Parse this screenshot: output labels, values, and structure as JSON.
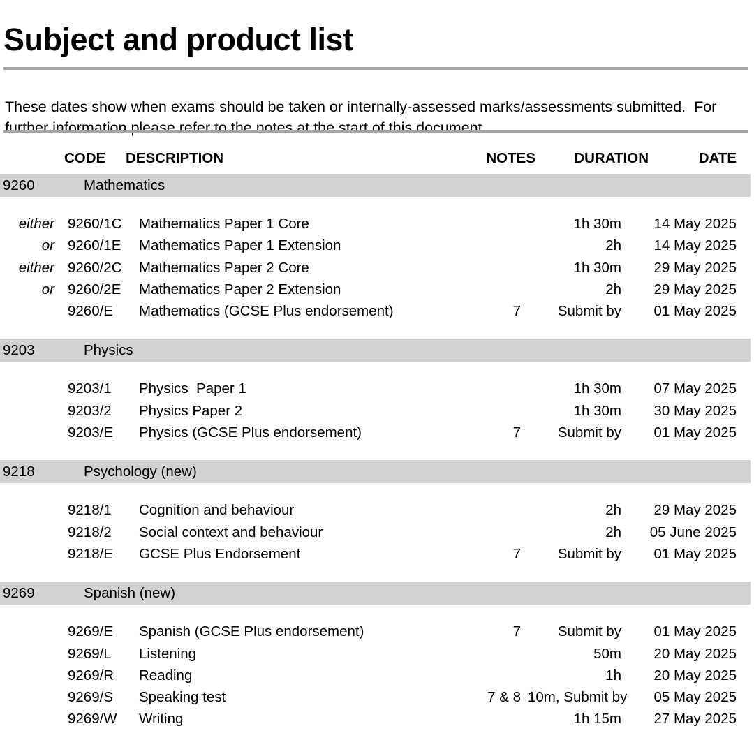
{
  "document": {
    "title": "Subject and product list",
    "intro": "These dates show when exams should be taken or internally-assessed marks/assessments submitted.  For further information please refer to the notes at the start of this document."
  },
  "colors": {
    "rule": "#a6a6a6",
    "subject_band": "#d2d2d2",
    "text": "#000000",
    "page_background": "#ffffff"
  },
  "table": {
    "headers": {
      "code": "CODE",
      "description": "DESCRIPTION",
      "notes": "NOTES",
      "duration": "DURATION",
      "date": "DATE"
    },
    "sections": [
      {
        "subject_code": "9260",
        "subject_name": "Mathematics",
        "rows": [
          {
            "eitheror": "either",
            "code": "9260/1C",
            "description": "Mathematics Paper 1 Core",
            "notes": "",
            "duration": "1h 30m",
            "date": "14 May 2025"
          },
          {
            "eitheror": "or",
            "code": "9260/1E",
            "description": "Mathematics Paper 1 Extension",
            "notes": "",
            "duration": "2h",
            "date": "14 May 2025"
          },
          {
            "eitheror": "either",
            "code": "9260/2C",
            "description": "Mathematics Paper 2 Core",
            "notes": "",
            "duration": "1h 30m",
            "date": "29 May 2025"
          },
          {
            "eitheror": "or",
            "code": "9260/2E",
            "description": "Mathematics Paper 2 Extension",
            "notes": "",
            "duration": "2h",
            "date": "29 May 2025"
          },
          {
            "eitheror": "",
            "code": "9260/E",
            "description": "Mathematics (GCSE Plus endorsement)",
            "notes": "7",
            "duration": "Submit by",
            "date": "01 May 2025"
          }
        ]
      },
      {
        "subject_code": "9203",
        "subject_name": "Physics",
        "rows": [
          {
            "eitheror": "",
            "code": "9203/1",
            "description": "Physics  Paper 1",
            "notes": "",
            "duration": "1h 30m",
            "date": "07 May 2025"
          },
          {
            "eitheror": "",
            "code": "9203/2",
            "description": "Physics Paper 2",
            "notes": "",
            "duration": "1h 30m",
            "date": "30 May 2025"
          },
          {
            "eitheror": "",
            "code": "9203/E",
            "description": "Physics (GCSE Plus endorsement)",
            "notes": "7",
            "duration": "Submit by",
            "date": "01 May 2025"
          }
        ]
      },
      {
        "subject_code": "9218",
        "subject_name": "Psychology (new)",
        "rows": [
          {
            "eitheror": "",
            "code": "9218/1",
            "description": "Cognition and behaviour",
            "notes": "",
            "duration": "2h",
            "date": "29 May 2025"
          },
          {
            "eitheror": "",
            "code": "9218/2",
            "description": "Social context and behaviour",
            "notes": "",
            "duration": "2h",
            "date": "05 June 2025"
          },
          {
            "eitheror": "",
            "code": "9218/E",
            "description": "GCSE Plus Endorsement",
            "notes": "7",
            "duration": "Submit by",
            "date": "01 May 2025"
          }
        ]
      },
      {
        "subject_code": "9269",
        "subject_name": "Spanish (new)",
        "rows": [
          {
            "eitheror": "",
            "code": "9269/E",
            "description": "Spanish (GCSE Plus endorsement)",
            "notes": "7",
            "duration": "Submit by",
            "date": "01 May 2025"
          },
          {
            "eitheror": "",
            "code": "9269/L",
            "description": "Listening",
            "notes": "",
            "duration": "50m",
            "date": "20 May 2025"
          },
          {
            "eitheror": "",
            "code": "9269/R",
            "description": "Reading",
            "notes": "",
            "duration": "1h",
            "date": "20 May 2025"
          },
          {
            "eitheror": "",
            "code": "9269/S",
            "description": "Speaking test",
            "notes": "7 & 8",
            "duration": "10m, Submit by",
            "date": "05 May 2025"
          },
          {
            "eitheror": "",
            "code": "9269/W",
            "description": "Writing",
            "notes": "",
            "duration": "1h 15m",
            "date": "27 May 2025"
          }
        ]
      }
    ]
  }
}
